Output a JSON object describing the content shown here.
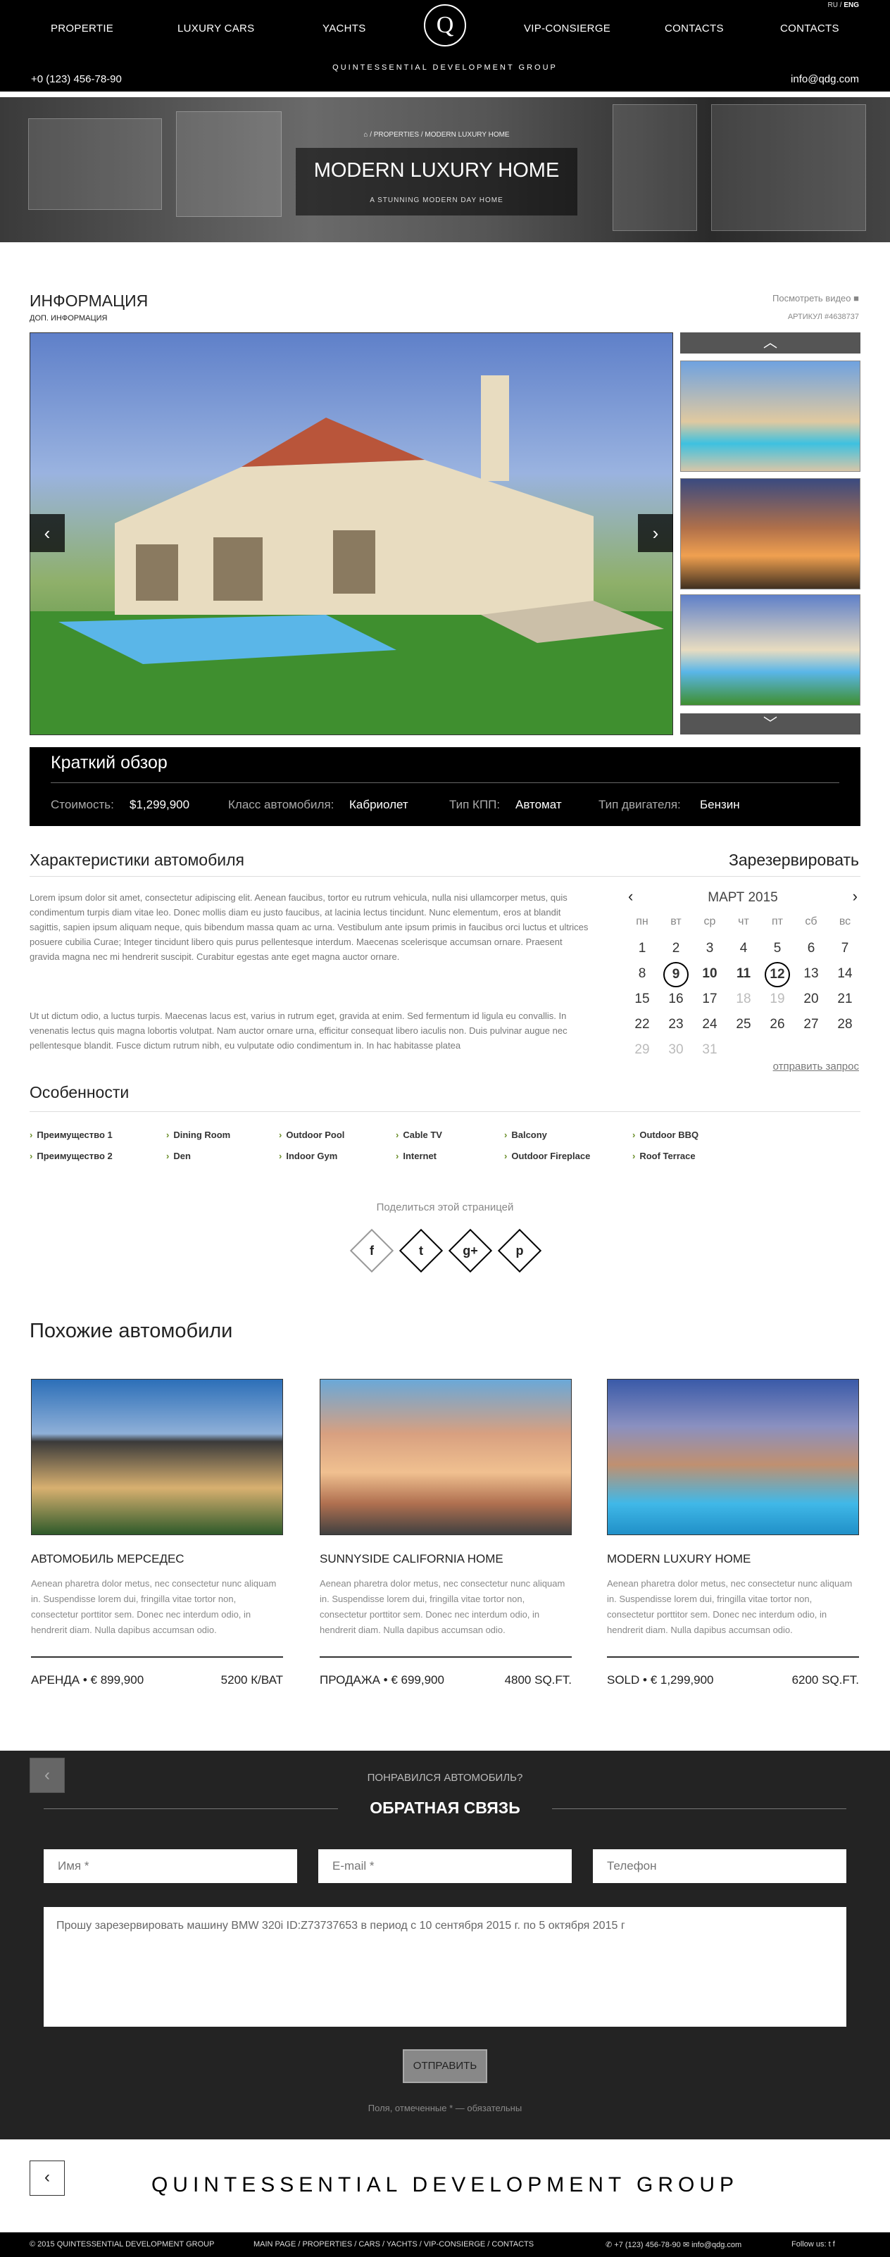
{
  "header": {
    "lang_ru": "RU",
    "lang_sep": "/",
    "lang_en": "ENG",
    "nav": [
      "PROPERTIE",
      "LUXURY CARS",
      "YACHTS",
      "VIP-CONSIERGE",
      "CONTACTS",
      "CONTACTS"
    ],
    "logo_letter": "Q",
    "logo_text": "QUINTESSENTIAL DEVELOPMENT GROUP",
    "phone": "+0 (123) 456-78-90",
    "email": "info@qdg.com"
  },
  "hero": {
    "breadcrumb": [
      "PROPERTIES",
      "MODERN LUXURY HOME"
    ],
    "title": "MODERN LUXURY HOME",
    "subtitle": "A STUNNING MODERN DAY HOME"
  },
  "info": {
    "title": "ИНФОРМАЦИЯ",
    "subtitle": "ДОП. ИНФОРМАЦИЯ",
    "video": "Посмотреть видео",
    "article": "АРТИКУЛ #4638737"
  },
  "overview": {
    "title": "Краткий обзор",
    "items": [
      {
        "label": "Стоимость:",
        "value": "$1,299,900"
      },
      {
        "label": "Класс автомобиля:",
        "value": "Кабриолет"
      },
      {
        "label": "Тип КПП:",
        "value": "Автомат"
      },
      {
        "label": "Тип двигателя:",
        "value": "Бензин"
      }
    ]
  },
  "specs": {
    "title": "Характеристики автомобиля",
    "booking": "Зарезервировать",
    "p1": "Lorem ipsum dolor sit amet, consectetur adipiscing elit. Aenean faucibus, tortor eu rutrum vehicula, nulla nisi ullamcorper metus, quis condimentum turpis diam vitae leo. Donec mollis diam eu justo faucibus, at lacinia lectus tincidunt. Nunc elementum, eros at blandit sagittis, sapien ipsum aliquam neque, quis bibendum massa quam ac urna. Vestibulum ante ipsum primis in faucibus orci luctus et ultrices posuere cubilia Curae; Integer tincidunt libero quis purus pellentesque interdum. Maecenas scelerisque accumsan ornare. Praesent gravida magna nec mi hendrerit suscipit. Curabitur egestas ante eget magna auctor ornare.",
    "p2": "Ut ut dictum odio, a luctus turpis. Maecenas lacus est, varius in rutrum eget, gravida at enim. Sed fermentum id ligula eu convallis. In venenatis lectus quis magna lobortis volutpat. Nam auctor ornare urna, efficitur consequat libero iaculis non. Duis pulvinar augue nec pellentesque blandit. Fusce dictum rutrum nibh, eu vulputate odio condimentum in. In hac habitasse platea"
  },
  "calendar": {
    "month": "МАРТ 2015",
    "weekdays": [
      "пн",
      "вт",
      "ср",
      "чт",
      "пт",
      "сб",
      "вс"
    ],
    "weeks": [
      [
        "1",
        "2",
        "3",
        "4",
        "5",
        "6",
        "7"
      ],
      [
        "8",
        "9",
        "10",
        "11",
        "12",
        "13",
        "14"
      ],
      [
        "15",
        "16",
        "17",
        "18",
        "19",
        "20",
        "21"
      ],
      [
        "22",
        "23",
        "24",
        "25",
        "26",
        "27",
        "28"
      ],
      [
        "29",
        "30",
        "31",
        "",
        "",
        "",
        ""
      ]
    ],
    "request": "отправить запрос"
  },
  "features": {
    "title": "Особенности",
    "items": [
      "Преимущество 1",
      "Dining Room",
      "Outdoor Pool",
      "Cable TV",
      "Balcony",
      "Outdoor BBQ",
      "Преимущество 2",
      "Den",
      "Indoor Gym",
      "Internet",
      "Outdoor Fireplace",
      "Roof Terrace"
    ]
  },
  "share": {
    "label": "Поделиться этой страницей",
    "icons": [
      "f",
      "t",
      "g+",
      "p"
    ]
  },
  "similar": {
    "title": "Похожие автомобили",
    "cards": [
      {
        "title": "АВТОМОБИЛЬ МЕРСЕДЕС",
        "desc": "Aenean pharetra dolor metus, nec consectetur nunc aliquam in. Suspendisse lorem dui, fringilla vitae tortor non, consectetur porttitor sem. Donec nec interdum odio, in hendrerit diam. Nulla dapibus accumsan odio.",
        "price": "АРЕНДА  •  € 899,900",
        "size": "5200 К/ВАТ"
      },
      {
        "title": "SUNNYSIDE CALIFORNIA HOME",
        "desc": "Aenean pharetra dolor metus, nec consectetur nunc aliquam in. Suspendisse lorem dui, fringilla vitae tortor non, consectetur porttitor sem. Donec nec interdum odio, in hendrerit diam. Nulla dapibus accumsan odio.",
        "price": "ПРОДАЖА  •  € 699,900",
        "size": "4800 SQ.FT."
      },
      {
        "title": "MODERN LUXURY HOME",
        "desc": "Aenean pharetra dolor metus, nec consectetur nunc aliquam in. Suspendisse lorem dui, fringilla vitae tortor non, consectetur porttitor sem. Donec nec interdum odio, in hendrerit diam. Nulla dapibus accumsan odio.",
        "price": "SOLD  •  € 1,299,900",
        "size": "6200 SQ.FT."
      }
    ]
  },
  "contact": {
    "subtitle": "ПОНРАВИЛСЯ АВТОМОБИЛЬ?",
    "title": "ОБРАТНАЯ СВЯЗЬ",
    "name_ph": "Имя *",
    "email_ph": "E-mail *",
    "phone_ph": "Телефон",
    "message": "Прошу зарезервировать машину BMW 320i ID:Z73737653 в период с 10 сентября 2015 г. по 5 октября 2015 г",
    "submit": "ОТПРАВИТЬ",
    "note": "Поля, отмеченные * — обязательны"
  },
  "footer": {
    "brand": "QUINTESSENTIAL DEVELOPMENT GROUP",
    "copyright": "© 2015 QUINTESSENTIAL DEVELOPMENT GROUP",
    "nav": "MAIN PAGE  /  PROPERTIES  /  CARS  /  YACHTS  /  VIP-CONSIERGE  /  CONTACTS",
    "phone": "+7 (123) 456-78-90",
    "email": "info@qdg.com",
    "follow": "Follow us:"
  }
}
